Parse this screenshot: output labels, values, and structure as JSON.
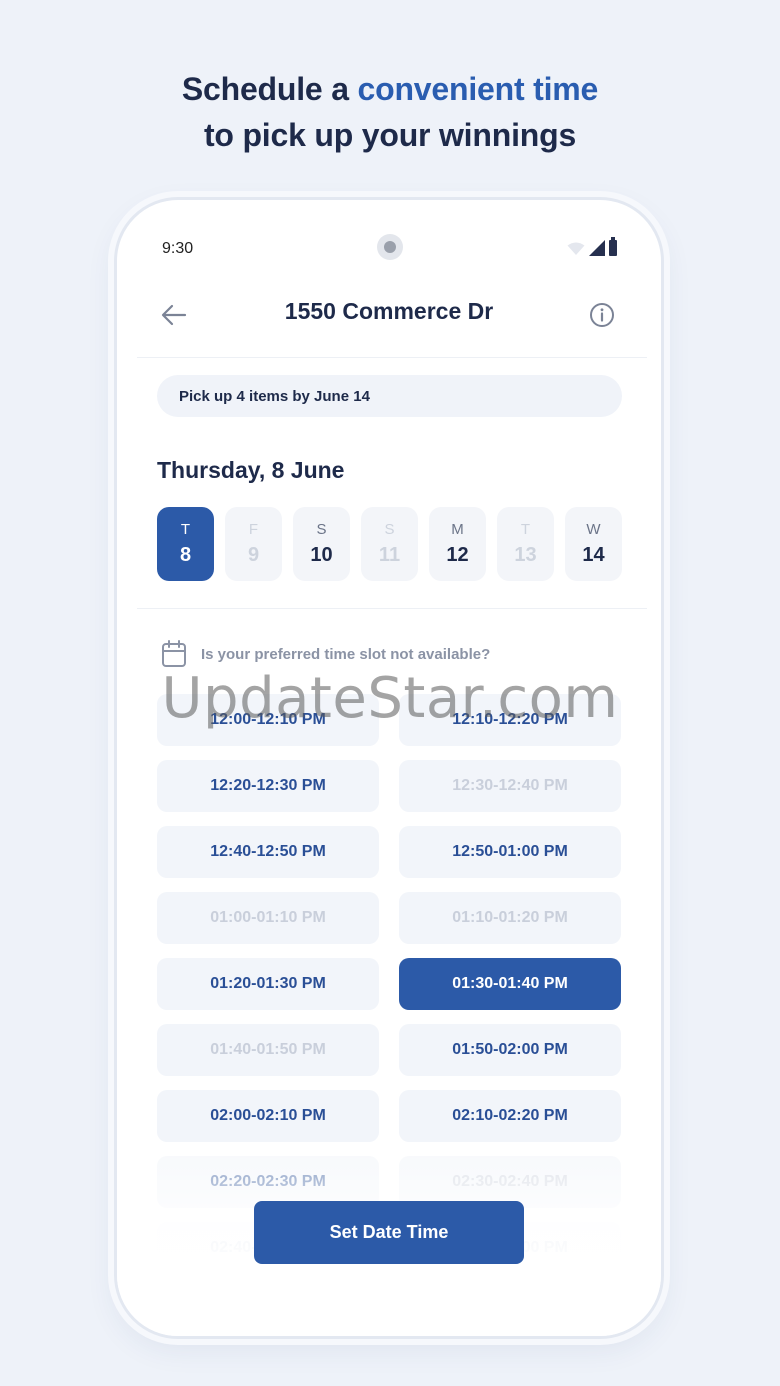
{
  "headline": {
    "line1_prefix": "Schedule a ",
    "line1_accent": "convenient time",
    "line2": "to pick up your winnings"
  },
  "status_bar": {
    "time": "9:30",
    "icons": [
      "wifi-icon",
      "signal-icon",
      "battery-icon"
    ]
  },
  "header": {
    "title": "1550 Commerce Dr",
    "back_icon": "arrow-left-icon",
    "info_icon": "info-icon"
  },
  "pickup_notice": "Pick up 4 items by June 14",
  "selected_date_title": "Thursday, 8 June",
  "days": [
    {
      "dow": "T",
      "num": "8",
      "state": "selected"
    },
    {
      "dow": "F",
      "num": "9",
      "state": "disabled"
    },
    {
      "dow": "S",
      "num": "10",
      "state": "available"
    },
    {
      "dow": "S",
      "num": "11",
      "state": "disabled"
    },
    {
      "dow": "M",
      "num": "12",
      "state": "available"
    },
    {
      "dow": "T",
      "num": "13",
      "state": "disabled"
    },
    {
      "dow": "W",
      "num": "14",
      "state": "available"
    }
  ],
  "unavailable_prompt": "Is your preferred time slot not available?",
  "time_slots": [
    {
      "label": "12:00-12:10 PM",
      "state": "available"
    },
    {
      "label": "12:10-12:20 PM",
      "state": "available"
    },
    {
      "label": "12:20-12:30 PM",
      "state": "available"
    },
    {
      "label": "12:30-12:40 PM",
      "state": "disabled"
    },
    {
      "label": "12:40-12:50 PM",
      "state": "available"
    },
    {
      "label": "12:50-01:00 PM",
      "state": "available"
    },
    {
      "label": "01:00-01:10 PM",
      "state": "disabled"
    },
    {
      "label": "01:10-01:20 PM",
      "state": "disabled"
    },
    {
      "label": "01:20-01:30 PM",
      "state": "available"
    },
    {
      "label": "01:30-01:40 PM",
      "state": "selected"
    },
    {
      "label": "01:40-01:50 PM",
      "state": "disabled"
    },
    {
      "label": "01:50-02:00 PM",
      "state": "available"
    },
    {
      "label": "02:00-02:10 PM",
      "state": "available"
    },
    {
      "label": "02:10-02:20 PM",
      "state": "available"
    },
    {
      "label": "02:20-02:30 PM",
      "state": "available"
    },
    {
      "label": "02:30-02:40 PM",
      "state": "disabled"
    },
    {
      "label": "02:40-02:50 PM",
      "state": "available"
    },
    {
      "label": "02:50-03:00 PM",
      "state": "available"
    }
  ],
  "set_button_label": "Set Date Time",
  "watermark": "UpdateStar.com",
  "colors": {
    "accent": "#2c5aa8",
    "background": "#eef2f9",
    "text_dark": "#1e2a4a"
  }
}
